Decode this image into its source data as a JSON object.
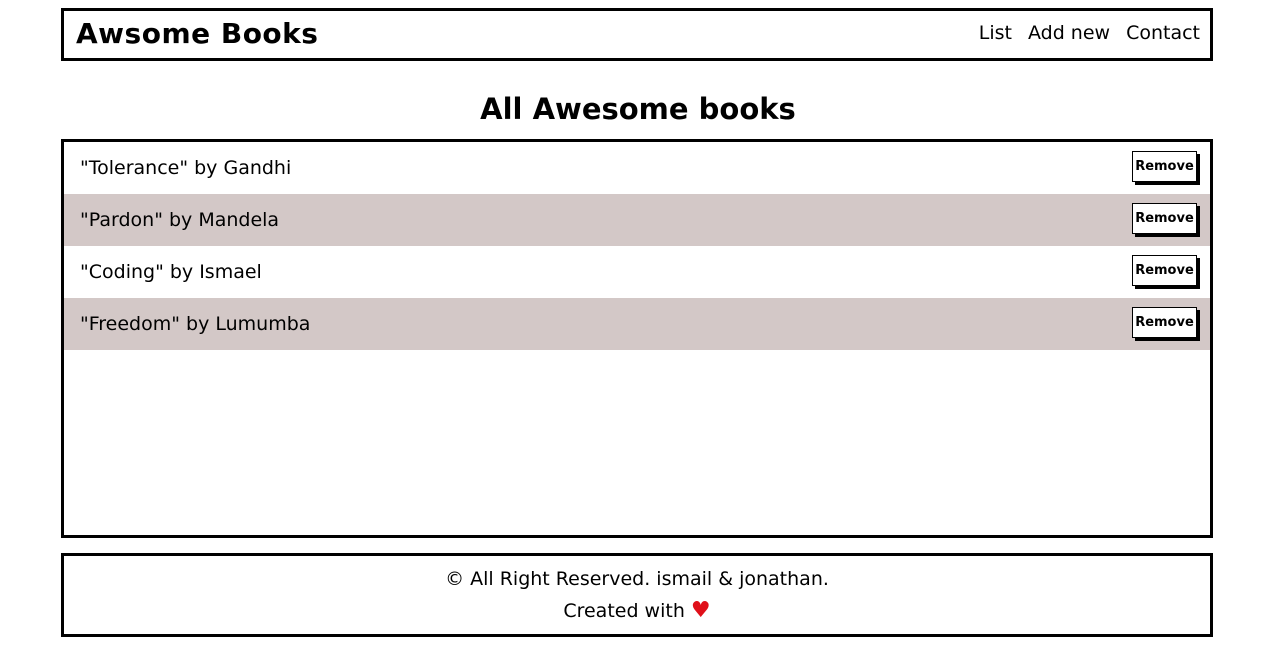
{
  "header": {
    "logo": "Awsome Books",
    "nav": [
      {
        "label": "List"
      },
      {
        "label": "Add new"
      },
      {
        "label": "Contact"
      }
    ]
  },
  "main": {
    "title": "All Awesome books",
    "books": [
      {
        "text": "\"Tolerance\" by Gandhi",
        "remove_label": "Remove"
      },
      {
        "text": "\"Pardon\" by Mandela",
        "remove_label": "Remove"
      },
      {
        "text": "\"Coding\" by Ismael",
        "remove_label": "Remove"
      },
      {
        "text": "\"Freedom\" by Lumumba",
        "remove_label": "Remove"
      }
    ]
  },
  "footer": {
    "copyright": "© All Right Reserved. ismail & jonathan.",
    "created_with": "Created with",
    "heart": "♥"
  },
  "colors": {
    "alt_row_bg": "#d3c8c7",
    "heart": "#e0101a",
    "border": "#000000"
  }
}
